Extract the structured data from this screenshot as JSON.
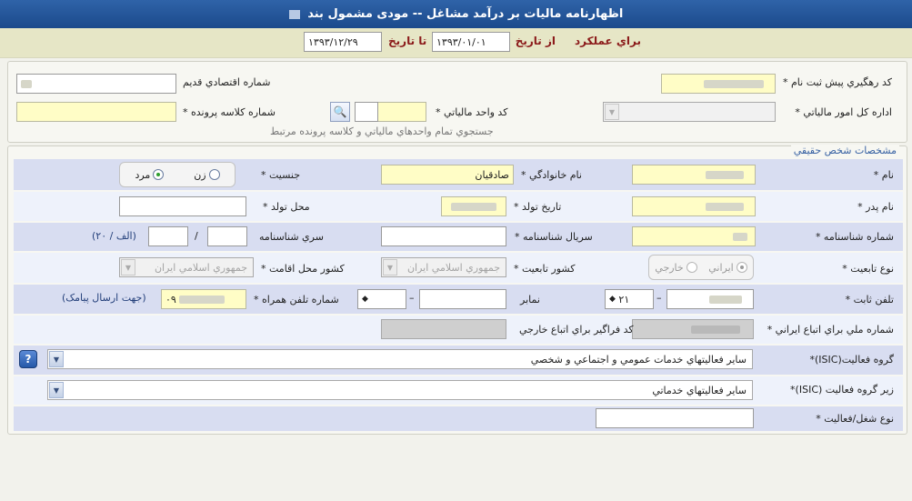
{
  "title": "اظهارنامه ماليات بر درآمد مشاغل -- مودی مشمول بند",
  "period": {
    "label": "براي عملكرد",
    "from_label": "از تاريخ",
    "from_value": "۱۳۹۳/۰۱/۰۱",
    "to_label": "تا تاريخ",
    "to_value": "۱۳۹۳/۱۲/۲۹"
  },
  "registration": {
    "tracking_code_label": "کد رهگيري پيش ثبت نام *",
    "old_economic_no_label": "شماره اقتصادي قديم",
    "tax_office_label": "اداره کل امور مالياتي *",
    "tax_unit_label": "کد واحد مالياتي *",
    "file_class_label": "شماره کلاسه پرونده *",
    "search_note": "جستجوي تمام واحدهاي مالياتي و کلاسه پرونده مرتبط"
  },
  "person": {
    "legend": "مشخصات شخص حقيقي",
    "name_label": "نام *",
    "family_label": "نام خانوادگي *",
    "family_value": "صادقيان",
    "gender_label": "جنسيت *",
    "gender_female": "زن",
    "gender_male": "مرد",
    "father_label": "نام پدر *",
    "birth_date_label": "تاريخ تولد *",
    "birth_place_label": "محل تولد *",
    "id_no_label": "شماره شناسنامه *",
    "id_serial_label": "سريال شناسنامه *",
    "id_series_label": "سري شناسنامه",
    "id_series_slash": "/",
    "id_series_hint": "(۲۰ / الف)",
    "nationality_type_label": "نوع تابعيت *",
    "nat_iranian": "ايراني",
    "nat_foreign": "خارجي",
    "citizenship_label": "کشور تابعيت *",
    "citizenship_value": "جمهوري اسلامي ايران",
    "residence_label": "کشور محل اقامت *",
    "residence_value": "جمهوري اسلامي ايران",
    "phone_label": "تلفن ثابت *",
    "phone_prefix": "۲۱",
    "phone_dash": "–",
    "fax_label": "نمابر",
    "fax_dash": "–",
    "mobile_label": "شماره تلفن همراه *",
    "mobile_prefix": "۰۹",
    "mobile_hint": "(جهت ارسال پيامک)",
    "national_id_label": "شماره ملي براي اتباع ايراني *",
    "foreign_code_label": "کد فراگير براي اتباع خارجي",
    "isic_group_label": "گروه فعاليت(ISIC)*",
    "isic_group_value": "ساير فعاليتهاي خدمات عمومي و اجتماعي و شخصي",
    "isic_subgroup_label": "زير گروه فعاليت (ISIC)*",
    "isic_subgroup_value": "ساير فعاليتهاي خدماتي",
    "job_type_label": "نوع شغل/فعاليت *"
  }
}
